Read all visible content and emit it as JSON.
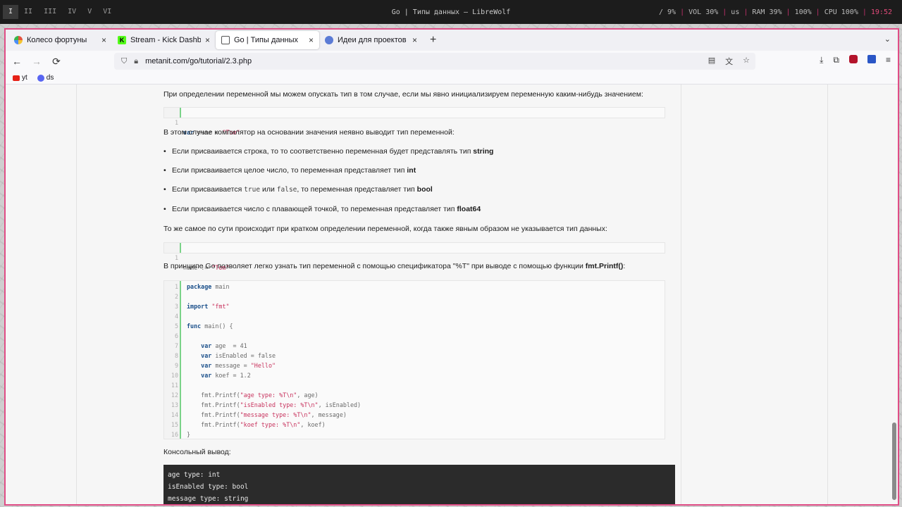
{
  "statusbar": {
    "workspaces": [
      "I",
      "II",
      "III",
      "IV",
      "V",
      "VI"
    ],
    "title": "Go | Типы данных — LibreWolf",
    "disk": "/ 9%",
    "volume": "VOL 30%",
    "layout": "us",
    "ram": "RAM 39%",
    "battery": "100%",
    "cpu": "CPU 100%",
    "clock": "19:52"
  },
  "tabs": [
    {
      "label": "Колесо фортуны",
      "close": "×",
      "icon": "wheel-icon"
    },
    {
      "label": "Stream - Kick Dashboar",
      "close": "×",
      "icon": "kick-icon"
    },
    {
      "label": "Go | Типы данных",
      "close": "×",
      "icon": "go-icon"
    },
    {
      "label": "Идеи для проектов на G",
      "close": "×",
      "icon": "idea-icon"
    }
  ],
  "toolbar": {
    "new_tab": "+",
    "tab_list": "⌄",
    "back": "←",
    "forward": "→",
    "reload": "⟳",
    "url": "metanit.com/go/tutorial/2.3.php"
  },
  "bookmarks": [
    {
      "label": "yt",
      "icon": "youtube-icon"
    },
    {
      "label": "ds",
      "icon": "discord-icon"
    }
  ],
  "article": {
    "p1": "При определении переменной мы можем опускать тип в том случае, если мы явно инициализируем переменную каким-нибудь значением:",
    "code1": {
      "ln": "1",
      "kw": "var",
      "rest": " name = ",
      "str": "\"Tom\""
    },
    "p2": "В этом случае компилятор на основании значения неявно выводит тип переменной:",
    "bullets": [
      {
        "pre": "Если присваивается строка, то то соответственно переменная будет представлять тип ",
        "bold": "string"
      },
      {
        "pre": "Если присваивается целое число, то переменная представляет тип ",
        "bold": "int"
      },
      {
        "pre": "Если присваивается ",
        "code_a": "true",
        "mid": " или ",
        "code_b": "false",
        "post": ", то переменная представляет тип ",
        "bold": "bool"
      },
      {
        "pre": "Если присваивается число с плавающей точкой, то переменная представляет тип ",
        "bold": "float64"
      }
    ],
    "p3": "То же самое по сути происходит при кратком определении переменной, когда также явным образом не указывается тип данных:",
    "code2": {
      "ln": "1",
      "rest": "name := ",
      "str": "\"Tom\""
    },
    "p4_pre": "В принципе Go позволяет легко узнать тип переменной с помощью спецификатора \"%T\" при выводе с помощью функции ",
    "p4_bold": "fmt.Printf()",
    "p4_post": ":",
    "code3": [
      {
        "ln": "1",
        "kw": "package",
        "rest": " main",
        "str": ""
      },
      {
        "ln": "2",
        "kw": "",
        "rest": "",
        "str": ""
      },
      {
        "ln": "3",
        "kw": "import",
        "rest": " ",
        "str": "\"fmt\""
      },
      {
        "ln": "4",
        "kw": "",
        "rest": "",
        "str": ""
      },
      {
        "ln": "5",
        "kw": "func",
        "rest": " main() {",
        "str": ""
      },
      {
        "ln": "6",
        "kw": "",
        "rest": "",
        "str": ""
      },
      {
        "ln": "7",
        "kw": "    var",
        "rest": " age  = 41",
        "str": ""
      },
      {
        "ln": "8",
        "kw": "    var",
        "rest": " isEnabled = false",
        "str": ""
      },
      {
        "ln": "9",
        "kw": "    var",
        "rest": " message = ",
        "str": "\"Hello\""
      },
      {
        "ln": "10",
        "kw": "    var",
        "rest": " koef = 1.2",
        "str": ""
      },
      {
        "ln": "11",
        "kw": "",
        "rest": "",
        "str": ""
      },
      {
        "ln": "12",
        "kw": "",
        "rest": "    fmt.Printf(",
        "str": "\"age type: %T\\n\"",
        "tail": ", age)"
      },
      {
        "ln": "13",
        "kw": "",
        "rest": "    fmt.Printf(",
        "str": "\"isEnabled type: %T\\n\"",
        "tail": ", isEnabled)"
      },
      {
        "ln": "14",
        "kw": "",
        "rest": "    fmt.Printf(",
        "str": "\"message type: %T\\n\"",
        "tail": ", message)"
      },
      {
        "ln": "15",
        "kw": "",
        "rest": "    fmt.Printf(",
        "str": "\"koef type: %T\\n\"",
        "tail": ", koef)"
      },
      {
        "ln": "16",
        "kw": "",
        "rest": "}",
        "str": ""
      }
    ],
    "console_label": "Консольный вывод:",
    "console": [
      "age type: int",
      "isEnabled type: bool",
      "message type: string"
    ]
  }
}
